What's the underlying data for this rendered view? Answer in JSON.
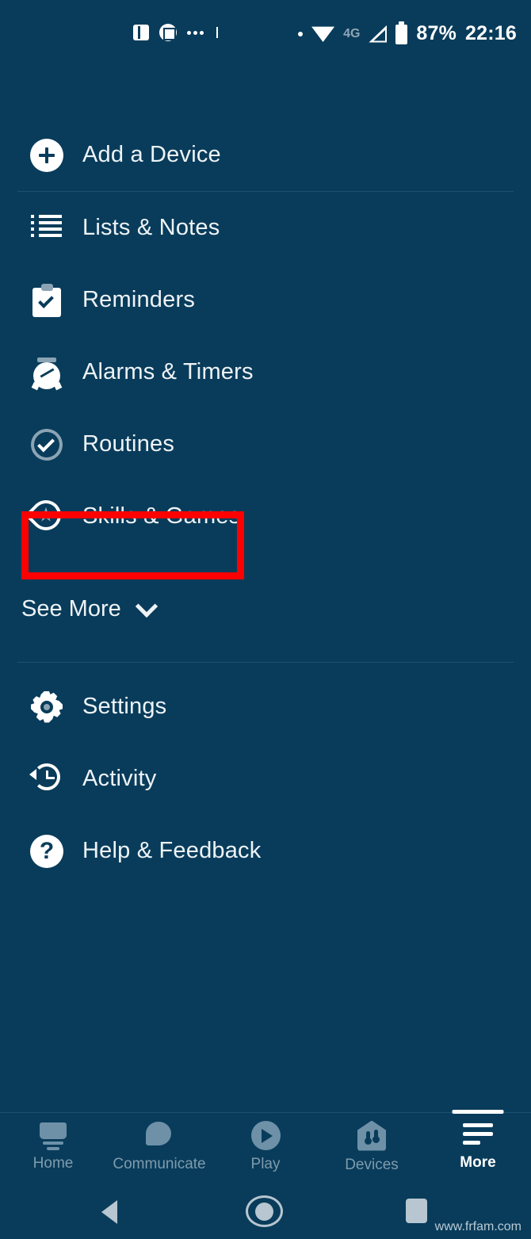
{
  "app": {
    "background_color": "#093c5b",
    "text_color": "#eef3f6",
    "highlight_color": "#ff0000",
    "inactive_tab_color": "#7e9bad"
  },
  "status_bar": {
    "left_icons": [
      "split-screen-icon",
      "screenshot-edit-icon",
      "more-notifications-icon"
    ],
    "network_label": "4G",
    "battery_percent": "87%",
    "clock": "22:16"
  },
  "menu": {
    "add_device": {
      "label": "Add a Device",
      "icon": "plus-circle-icon"
    },
    "items": [
      {
        "label": "Lists & Notes",
        "icon": "list-lines-icon"
      },
      {
        "label": "Reminders",
        "icon": "clipboard-check-icon"
      },
      {
        "label": "Alarms & Timers",
        "icon": "alarm-clock-icon"
      },
      {
        "label": "Routines",
        "icon": "refresh-check-icon"
      },
      {
        "label": "Skills & Games",
        "icon": "pin-star-icon",
        "highlighted": true
      }
    ],
    "see_more": {
      "label": "See More",
      "icon": "chevron-down-icon"
    },
    "secondary_items": [
      {
        "label": "Settings",
        "icon": "gear-icon"
      },
      {
        "label": "Activity",
        "icon": "history-clock-icon"
      },
      {
        "label": "Help & Feedback",
        "icon": "question-circle-icon"
      }
    ]
  },
  "bottom_nav": {
    "tabs": [
      {
        "label": "Home",
        "icon": "echo-device-icon",
        "active": false
      },
      {
        "label": "Communicate",
        "icon": "speech-bubble-icon",
        "active": false
      },
      {
        "label": "Play",
        "icon": "play-circle-icon",
        "active": false
      },
      {
        "label": "Devices",
        "icon": "smart-home-icon",
        "active": false
      },
      {
        "label": "More",
        "icon": "hamburger-icon",
        "active": true
      }
    ]
  },
  "system_bar": {
    "back": "back-triangle-icon",
    "home": "home-circle-icon",
    "recents": "recents-square-icon"
  },
  "watermark": "www.frfam.com"
}
